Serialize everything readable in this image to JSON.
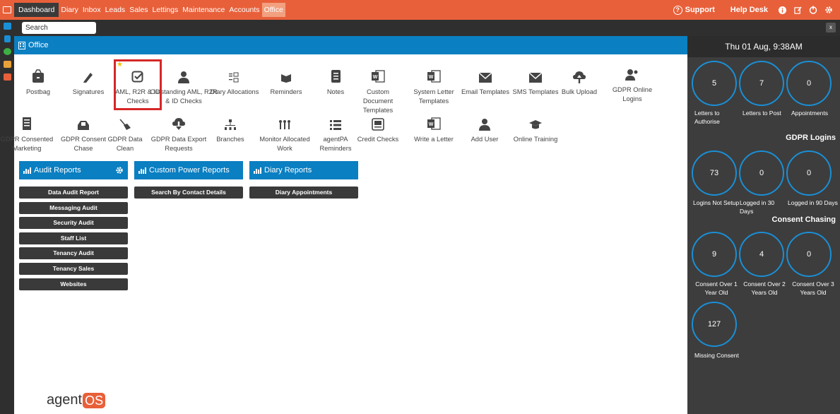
{
  "nav": {
    "items": [
      "Dashboard",
      "Diary",
      "Inbox",
      "Leads",
      "Sales",
      "Lettings",
      "Maintenance",
      "Accounts",
      "Office"
    ],
    "active": "Office"
  },
  "header": {
    "support": "Support",
    "help_desk": "Help Desk"
  },
  "search": {
    "placeholder": "Search",
    "close": "x"
  },
  "office": {
    "title": "Office"
  },
  "tiles": [
    {
      "label": "Postbag",
      "icon": "postbag-icon"
    },
    {
      "label": "Signatures",
      "icon": "pen-icon"
    },
    {
      "label": "AML, R2R & ID Checks",
      "icon": "checkbox-icon"
    },
    {
      "label": "Outstanding AML, R2R & ID Checks",
      "icon": "user-icon"
    },
    {
      "label": "Diary Allocations",
      "icon": "checklist-icon"
    },
    {
      "label": "Reminders",
      "icon": "reminder-icon"
    },
    {
      "label": "Notes",
      "icon": "notebook-icon"
    },
    {
      "label": "Custom Document Templates",
      "icon": "word-icon"
    },
    {
      "label": "System Letter Templates",
      "icon": "word-icon"
    },
    {
      "label": "Email Templates",
      "icon": "envelope-icon"
    },
    {
      "label": "SMS Templates",
      "icon": "envelope-icon"
    },
    {
      "label": "Bulk Upload",
      "icon": "cloud-upload-icon"
    },
    {
      "label": "GDPR Online Logins",
      "icon": "users-icon"
    },
    {
      "label": "GDPR Consented Marketing",
      "icon": "document-icon"
    },
    {
      "label": "GDPR Consent Chase",
      "icon": "inbox-icon"
    },
    {
      "label": "GDPR Data Clean",
      "icon": "broom-icon"
    },
    {
      "label": "GDPR Data Export Requests",
      "icon": "cloud-download-icon"
    },
    {
      "label": "Branches",
      "icon": "sitemap-icon"
    },
    {
      "label": "Monitor Allocated Work",
      "icon": "team-icon"
    },
    {
      "label": "agentPA Reminders",
      "icon": "list-icon"
    },
    {
      "label": "Credit Checks",
      "icon": "id-card-icon"
    },
    {
      "label": "Write a Letter",
      "icon": "word-icon"
    },
    {
      "label": "Add User",
      "icon": "user-icon"
    },
    {
      "label": "Online Training",
      "icon": "graduation-cap-icon"
    }
  ],
  "reports": {
    "audit": {
      "title": "Audit Reports",
      "items": [
        "Data Audit Report",
        "Messaging Audit",
        "Security Audit",
        "Staff List",
        "Tenancy Audit",
        "Tenancy Sales",
        "Websites"
      ]
    },
    "custom": {
      "title": "Custom Power Reports",
      "items": [
        "Search By Contact Details"
      ]
    },
    "diary": {
      "title": "Diary Reports",
      "items": [
        "Diary Appointments"
      ]
    }
  },
  "logo": {
    "text": "agent",
    "badge": "OS"
  },
  "stats": {
    "date": "Thu 01 Aug, 9:38AM",
    "row1": [
      {
        "value": "5",
        "label": "Letters to Authorise"
      },
      {
        "value": "7",
        "label": "Letters to Post"
      },
      {
        "value": "0",
        "label": "Appointments"
      }
    ],
    "gdpr_title": "GDPR Logins",
    "row2": [
      {
        "value": "73",
        "label": "Logins Not Setup"
      },
      {
        "value": "0",
        "label": "Logged in 30 Days"
      },
      {
        "value": "0",
        "label": "Logged in 90 Days"
      }
    ],
    "consent_title": "Consent Chasing",
    "row3": [
      {
        "value": "9",
        "label": "Consent Over 1 Year Old"
      },
      {
        "value": "4",
        "label": "Consent Over 2 Years Old"
      },
      {
        "value": "0",
        "label": "Consent Over 3 Years Old"
      }
    ],
    "row4": [
      {
        "value": "127",
        "label": "Missing Consent"
      }
    ]
  },
  "colors": {
    "brand_orange": "#e8603a",
    "accent_blue": "#0a7fc2",
    "dark": "#2f2f2f",
    "highlight_red": "#d62728"
  }
}
